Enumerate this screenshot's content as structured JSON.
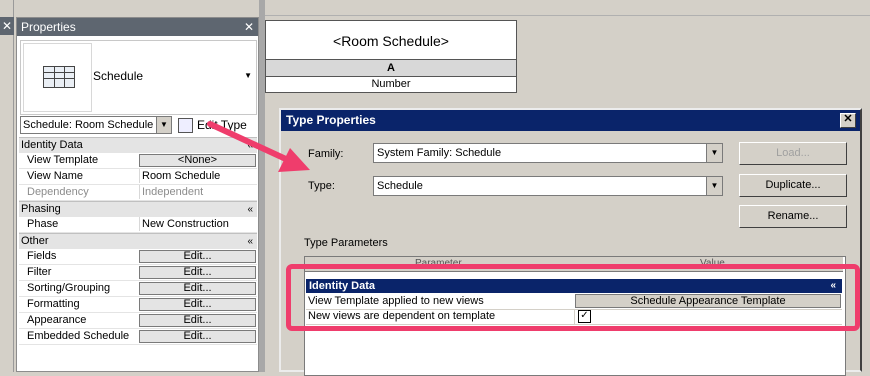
{
  "left_panel": {
    "close_glyph": "✕"
  },
  "properties": {
    "title": "Properties",
    "close_glyph": "✕",
    "type_name": "Schedule",
    "instance_selector": "Schedule: Room Schedule",
    "edit_type_label": "Edit Type",
    "sections": [
      {
        "name": "Identity Data",
        "rows": [
          {
            "key": "View Template",
            "value": "<None>",
            "button": true
          },
          {
            "key": "View Name",
            "value": "Room Schedule"
          },
          {
            "key": "Dependency",
            "value": "Independent",
            "grey": true
          }
        ]
      },
      {
        "name": "Phasing",
        "rows": [
          {
            "key": "Phase",
            "value": "New Construction"
          }
        ]
      },
      {
        "name": "Other",
        "rows": [
          {
            "key": "Fields",
            "value": "Edit...",
            "button": true
          },
          {
            "key": "Filter",
            "value": "Edit...",
            "button": true
          },
          {
            "key": "Sorting/Grouping",
            "value": "Edit...",
            "button": true
          },
          {
            "key": "Formatting",
            "value": "Edit...",
            "button": true
          },
          {
            "key": "Appearance",
            "value": "Edit...",
            "button": true
          },
          {
            "key": "Embedded Schedule",
            "value": "Edit...",
            "button": true
          }
        ]
      }
    ]
  },
  "schedule": {
    "title": "<Room Schedule>",
    "column_letter": "A",
    "column_header": "Number"
  },
  "dialog": {
    "title": "Type Properties",
    "close_glyph": "✕",
    "family_label": "Family:",
    "family_value": "System Family: Schedule",
    "type_label": "Type:",
    "type_value": "Schedule",
    "load_button": "Load...",
    "duplicate_button": "Duplicate...",
    "rename_button": "Rename...",
    "type_parameters_label": "Type Parameters",
    "grid_header_parameter": "Parameter",
    "grid_header_value": "Value",
    "section_name": "Identity Data",
    "rows": [
      {
        "key": "View Template applied to new views",
        "value": "Schedule Appearance Template"
      },
      {
        "key": "New views are dependent on template",
        "checked": true
      }
    ]
  },
  "annotation_color": "#ef3d6c"
}
